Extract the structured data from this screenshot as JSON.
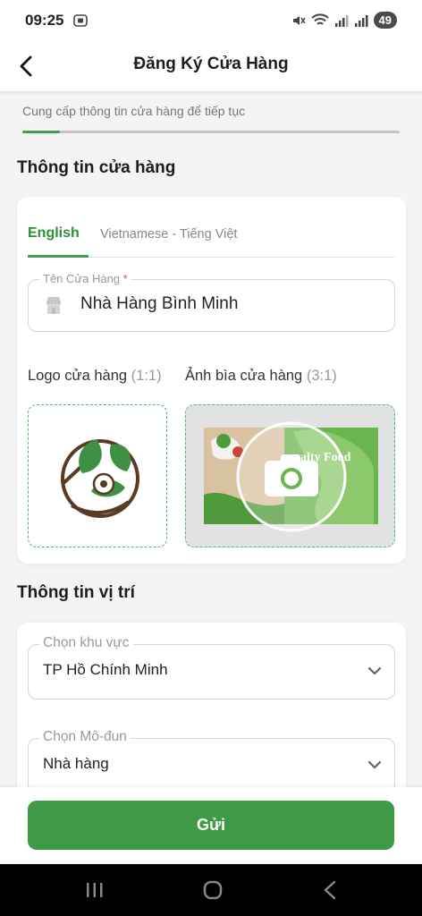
{
  "status": {
    "time": "09:25",
    "battery": "49"
  },
  "header": {
    "title": "Đăng Ký Cửa Hàng"
  },
  "subtitle": "Cung cấp thông tin cửa hàng để tiếp tục",
  "progress": 0.1,
  "store_section": {
    "title": "Thông tin cửa hàng",
    "tabs": [
      {
        "label": "English",
        "active": true
      },
      {
        "label": "Vietnamese - Tiếng Việt",
        "active": false
      }
    ],
    "name_field": {
      "label": "Tên Cửa Hàng",
      "required_mark": "*",
      "value": "Nhà Hàng Bình Minh",
      "icon": "store-icon"
    },
    "logo": {
      "label": "Logo cửa hàng",
      "ratio": "(1:1)"
    },
    "cover": {
      "label": "Ảnh bìa cửa hàng",
      "ratio": "(3:1)",
      "overlay_icon": "camera-icon"
    }
  },
  "location_section": {
    "title": "Thông tin vị trí",
    "region_select": {
      "label": "Chọn khu vực",
      "value": "TP Hồ Chính Minh"
    },
    "module_select": {
      "label": "Chọn Mô-đun",
      "value": "Nhà hàng"
    }
  },
  "submit_label": "Gửi",
  "colors": {
    "primary": "#41a047",
    "button": "#3f9a46",
    "required": "#e24b3a"
  }
}
